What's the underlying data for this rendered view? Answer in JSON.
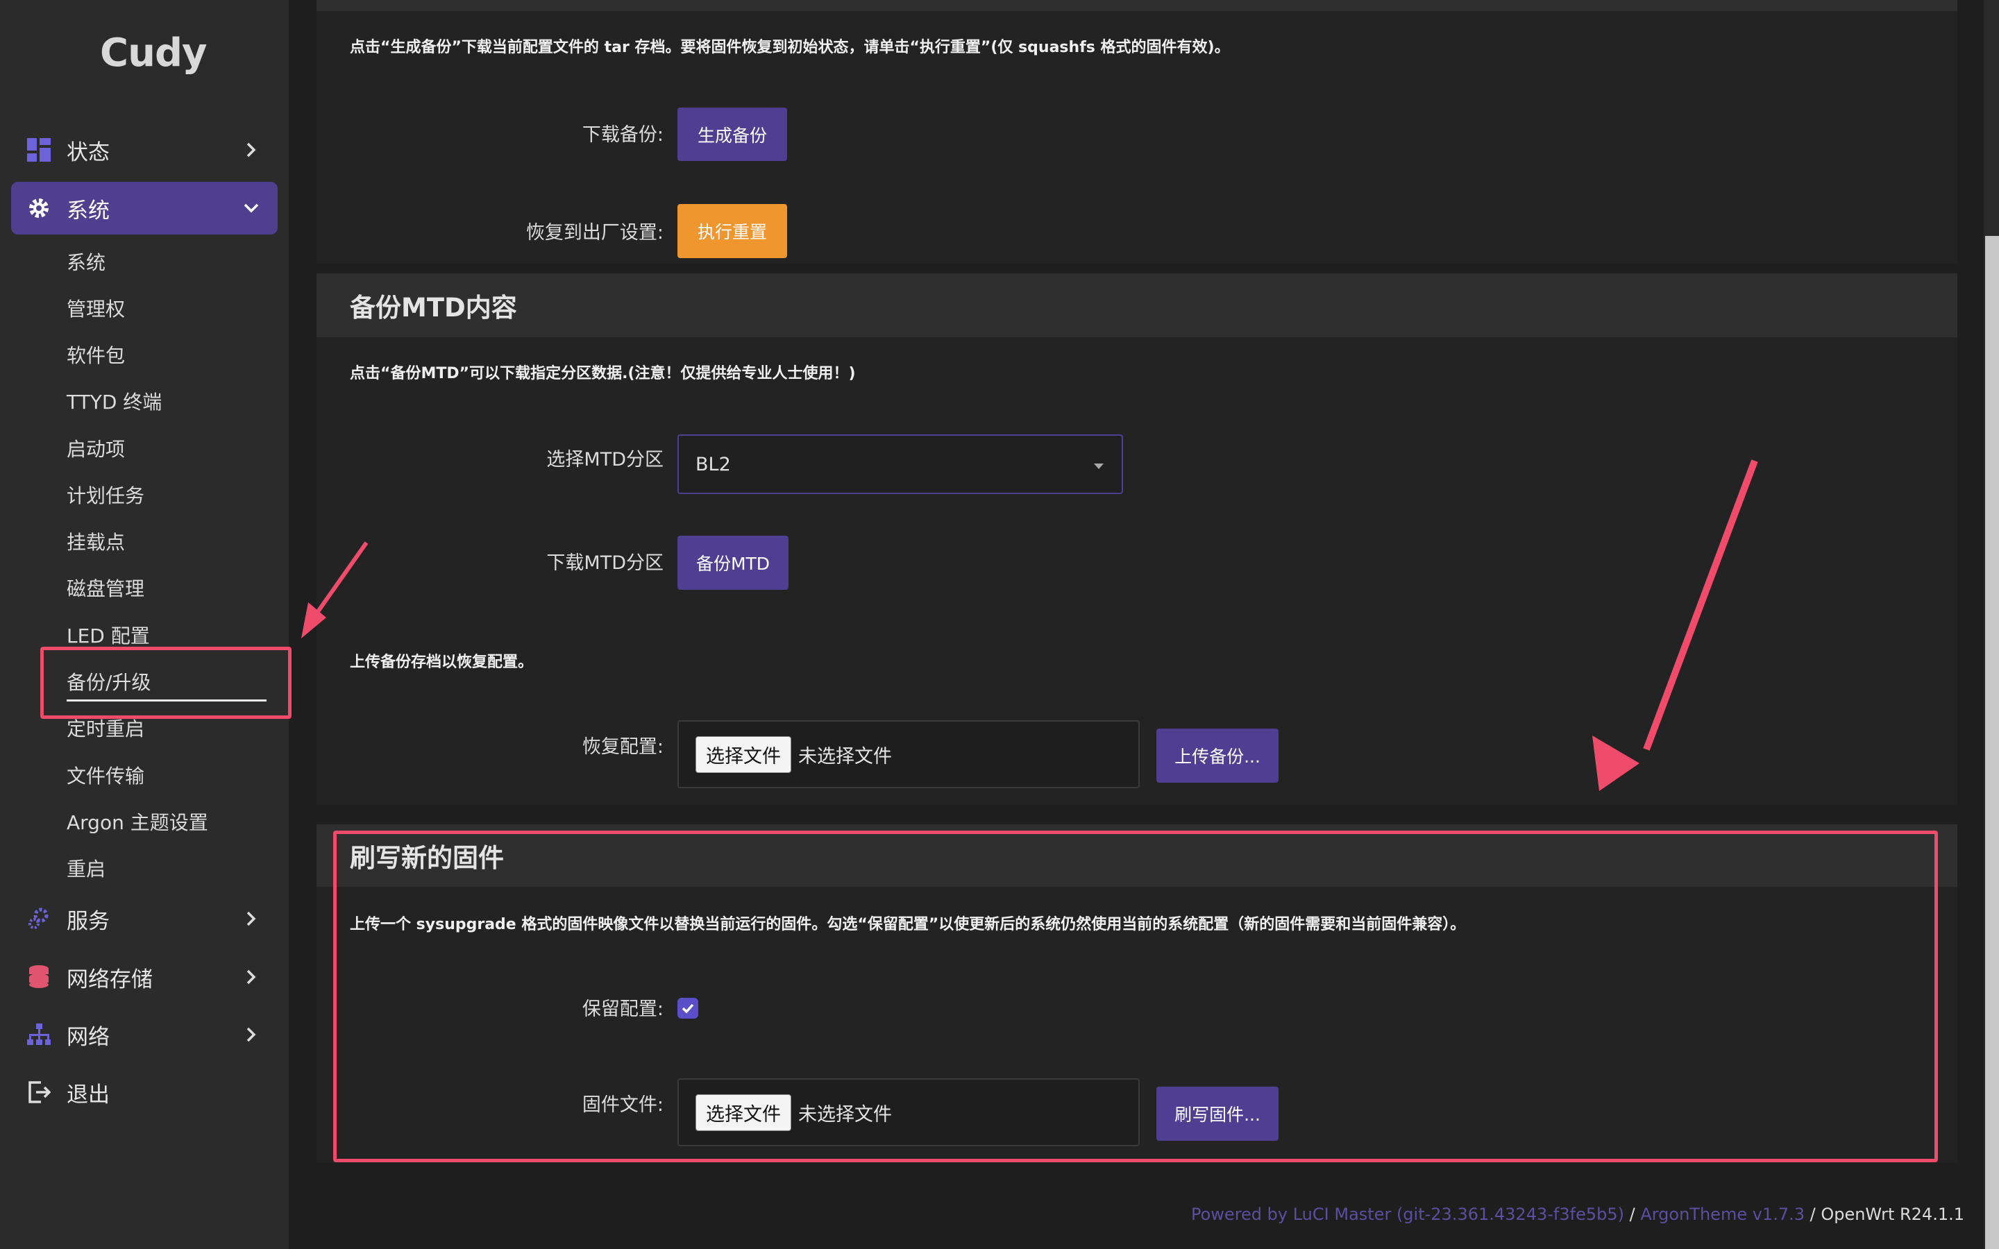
{
  "brand": {
    "logo": "Cudy"
  },
  "sidebar": {
    "top": [
      {
        "label": "状态",
        "icon": "dashboard-icon"
      },
      {
        "label": "系统",
        "icon": "gear-icon"
      },
      {
        "label": "服务",
        "icon": "services-icon"
      },
      {
        "label": "网络存储",
        "icon": "database-icon"
      },
      {
        "label": "网络",
        "icon": "network-icon"
      },
      {
        "label": "退出",
        "icon": "logout-icon"
      }
    ],
    "system_items": [
      "系统",
      "管理权",
      "软件包",
      "TTYD 终端",
      "启动项",
      "计划任务",
      "挂载点",
      "磁盘管理",
      "LED 配置",
      "备份/升级",
      "定时重启",
      "文件传输",
      "Argon 主题设置",
      "重启"
    ],
    "current_item": "备份/升级"
  },
  "backup": {
    "desc": "点击“生成备份”下载当前配置文件的 tar 存档。要将固件恢复到初始状态，请单击“执行重置”(仅 squashfs 格式的固件有效)。",
    "download_label": "下载备份:",
    "download_button": "生成备份",
    "reset_label": "恢复到出厂设置:",
    "reset_button": "执行重置"
  },
  "mtd": {
    "title": "备份MTD内容",
    "desc": "点击“备份MTD”可以下载指定分区数据.(注意！仅提供给专业人士使用！)",
    "select_label": "选择MTD分区",
    "select_value": "BL2",
    "download_label": "下载MTD分区",
    "download_button": "备份MTD",
    "restore_desc": "上传备份存档以恢复配置。",
    "restore_label": "恢复配置:",
    "choose_file": "选择文件",
    "no_file": "未选择文件",
    "upload_button": "上传备份..."
  },
  "flash": {
    "title": "刷写新的固件",
    "desc": "上传一个 sysupgrade 格式的固件映像文件以替换当前运行的固件。勾选“保留配置”以使更新后的系统仍然使用当前的系统配置（新的固件需要和当前固件兼容）。",
    "keep_label": "保留配置:",
    "keep_checked": true,
    "file_label": "固件文件:",
    "choose_file": "选择文件",
    "no_file": "未选择文件",
    "flash_button": "刷写固件..."
  },
  "footer": {
    "powered": "Powered by LuCI Master (git-23.361.43243-f3fe5b5)",
    "sep1": " / ",
    "theme": "ArgonTheme v1.7.3",
    "sep2": " / ",
    "os": "OpenWrt R24.1.1"
  },
  "colors": {
    "accent": "#4e3f93",
    "reset": "#f0962f",
    "highlight": "#ee4c6a"
  }
}
